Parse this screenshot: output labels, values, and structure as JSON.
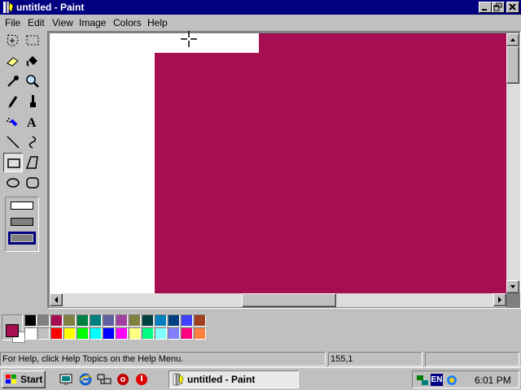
{
  "window": {
    "title": "untitled - Paint"
  },
  "menu": [
    "File",
    "Edit",
    "View",
    "Image",
    "Colors",
    "Help"
  ],
  "tools": [
    {
      "name": "free-form-select-icon"
    },
    {
      "name": "select-icon"
    },
    {
      "name": "eraser-icon"
    },
    {
      "name": "fill-icon"
    },
    {
      "name": "pick-color-icon"
    },
    {
      "name": "magnifier-icon"
    },
    {
      "name": "pencil-icon"
    },
    {
      "name": "brush-icon"
    },
    {
      "name": "airbrush-icon"
    },
    {
      "name": "text-icon"
    },
    {
      "name": "line-icon"
    },
    {
      "name": "curve-icon"
    },
    {
      "name": "rectangle-icon",
      "selected": true
    },
    {
      "name": "polygon-icon"
    },
    {
      "name": "ellipse-icon"
    },
    {
      "name": "rounded-rectangle-icon"
    }
  ],
  "tool_text_glyph": "A",
  "tool_options": {
    "selected_index": 2
  },
  "canvas": {
    "fill_color": "#a50f52",
    "background_color": "#ffffff"
  },
  "palette": {
    "foreground": "#a50f52",
    "background": "#ffffff",
    "row1": [
      "#000000",
      "#808080",
      "#a50f52",
      "#808040",
      "#008040",
      "#008080",
      "#6060a0",
      "#a040a0",
      "#808040",
      "#004040",
      "#0080c0",
      "#004080",
      "#4040ff",
      "#a04020"
    ],
    "row2": [
      "#ffffff",
      "#c0c0c0",
      "#ff0000",
      "#ffff00",
      "#00ff00",
      "#00ffff",
      "#0000ff",
      "#ff00ff",
      "#ffff80",
      "#00ff80",
      "#80ffff",
      "#8080ff",
      "#ff0080",
      "#ff8040"
    ]
  },
  "status": {
    "help_text": "For Help, click Help Topics on the Help Menu.",
    "coords": "155,1",
    "size": ""
  },
  "taskbar": {
    "start_label": "Start",
    "task_label": "untitled - Paint",
    "tray_lang": "EN",
    "clock": "6:01 PM"
  }
}
